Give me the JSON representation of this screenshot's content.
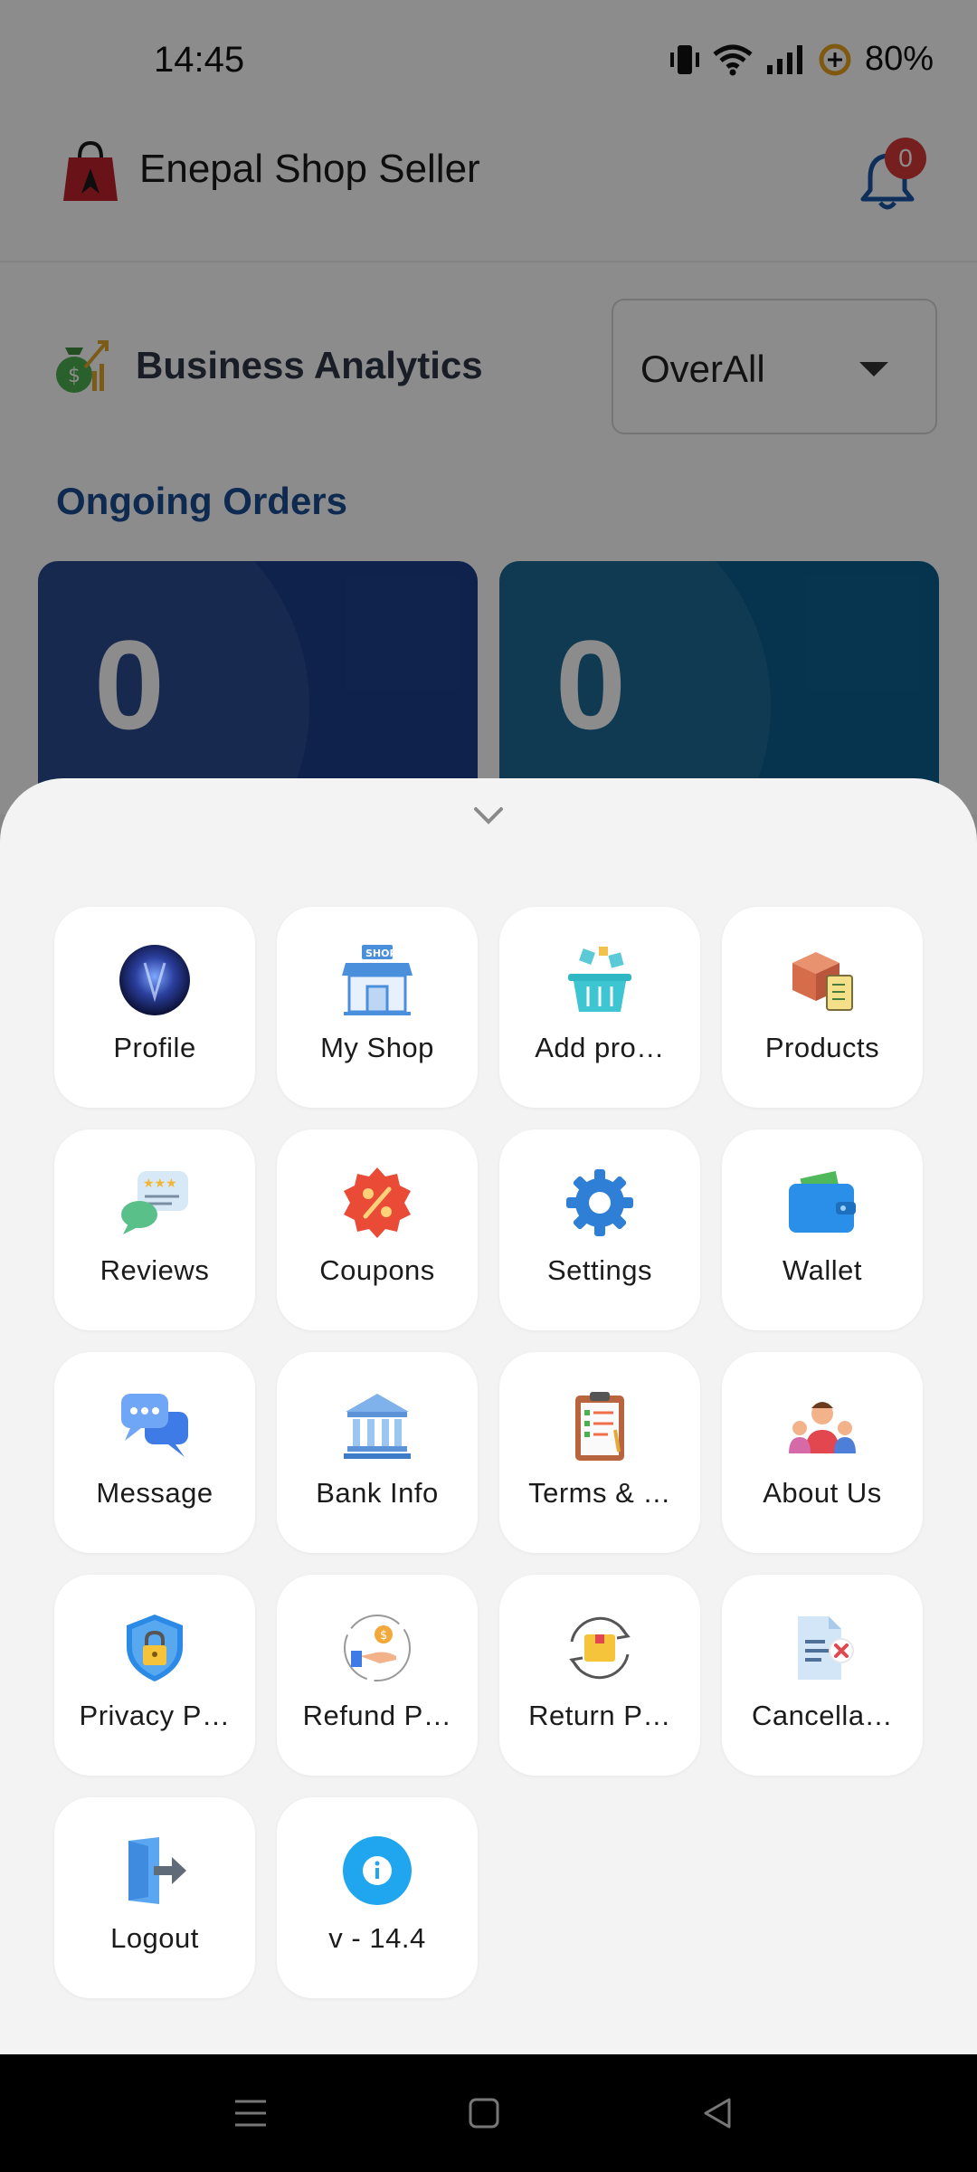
{
  "status_bar": {
    "time": "14:45",
    "battery": "80%"
  },
  "header": {
    "title": "Enepal Shop Seller",
    "notification_count": "0"
  },
  "analytics": {
    "title": "Business Analytics",
    "period": "OverAll"
  },
  "orders": {
    "section_title": "Ongoing Orders",
    "cards": [
      {
        "count": "0"
      },
      {
        "count": "0"
      }
    ]
  },
  "menu": {
    "items": [
      {
        "label": "Profile",
        "icon": "profile-avatar-icon"
      },
      {
        "label": "My Shop",
        "icon": "shop-icon"
      },
      {
        "label": "Add pro…",
        "icon": "add-product-basket-icon"
      },
      {
        "label": "Products",
        "icon": "products-box-icon"
      },
      {
        "label": "Reviews",
        "icon": "reviews-icon"
      },
      {
        "label": "Coupons",
        "icon": "coupon-percent-icon"
      },
      {
        "label": "Settings",
        "icon": "gear-icon"
      },
      {
        "label": "Wallet",
        "icon": "wallet-icon"
      },
      {
        "label": "Message",
        "icon": "chat-icon"
      },
      {
        "label": "Bank Info",
        "icon": "bank-icon"
      },
      {
        "label": "Terms & …",
        "icon": "clipboard-icon"
      },
      {
        "label": "About Us",
        "icon": "team-icon"
      },
      {
        "label": "Privacy P…",
        "icon": "shield-lock-icon"
      },
      {
        "label": "Refund P…",
        "icon": "refund-icon"
      },
      {
        "label": "Return P…",
        "icon": "return-box-icon"
      },
      {
        "label": "Cancella…",
        "icon": "cancel-document-icon"
      },
      {
        "label": "Logout",
        "icon": "logout-icon"
      },
      {
        "label": "v - 14.4",
        "icon": "info-icon"
      }
    ]
  },
  "colors": {
    "order_card_1": "#1c3f8a",
    "order_card_2": "#0c5f8f",
    "section_title": "#1a4d94",
    "notification_badge": "#d63a3a"
  }
}
